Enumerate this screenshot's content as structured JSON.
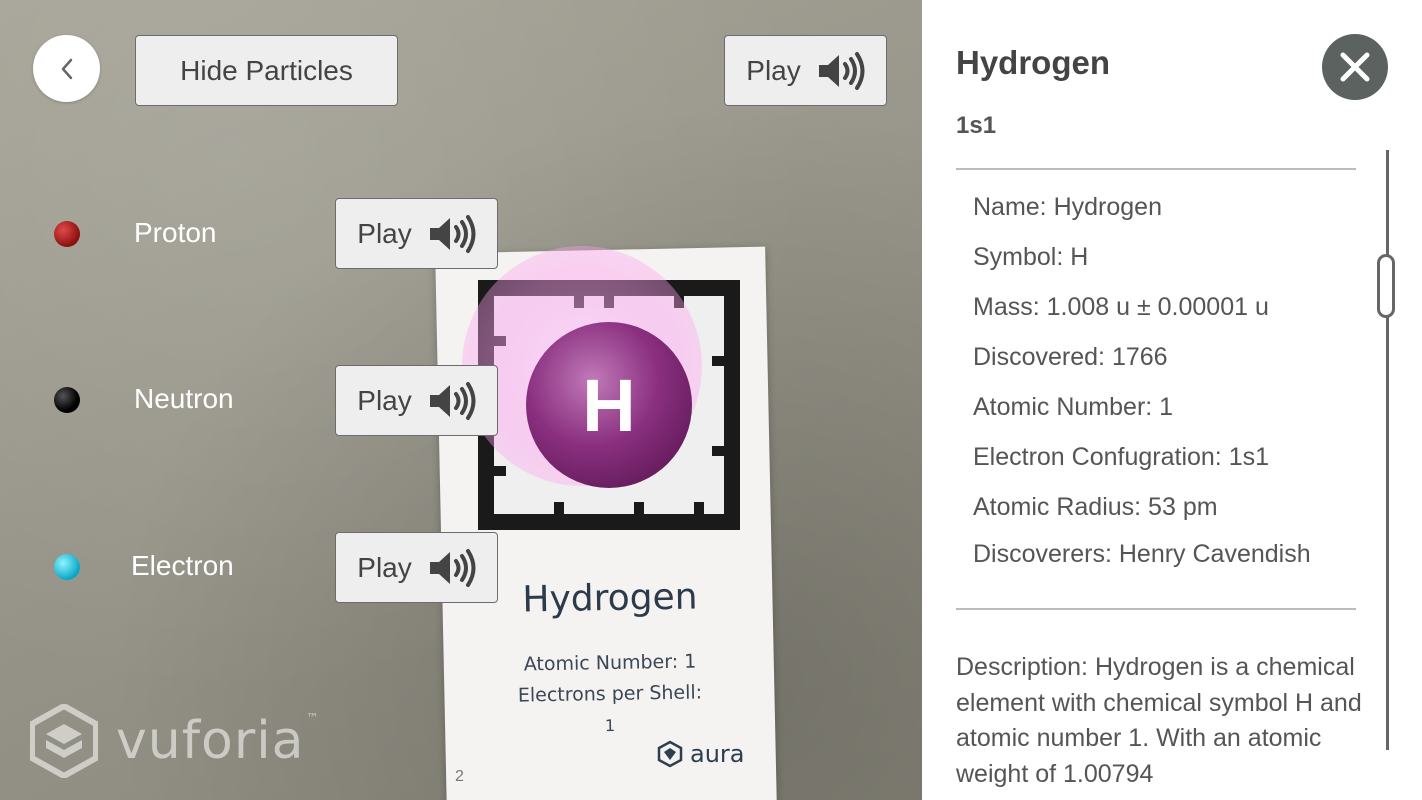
{
  "toolbar": {
    "back_icon": "chevron-left-icon",
    "hide_particles_label": "Hide Particles",
    "play_label": "Play"
  },
  "particles": [
    {
      "label": "Proton",
      "color": "#b81d1d",
      "play_label": "Play"
    },
    {
      "label": "Neutron",
      "color": "#000000",
      "play_label": "Play"
    },
    {
      "label": "Electron",
      "color": "#18c6e6",
      "play_label": "Play"
    }
  ],
  "ar_card": {
    "symbol": "H",
    "title": "Hydrogen",
    "line1": "Atomic Number: 1",
    "line2": "Electrons per Shell:",
    "line3": "1",
    "brand": "aura",
    "page_number": "2"
  },
  "watermark": {
    "text": "vuforia",
    "tm": "™"
  },
  "panel": {
    "title": "Hydrogen",
    "config": "1s1",
    "info": [
      "Name: Hydrogen",
      "Symbol: H",
      "Mass: 1.008 u ± 0.00001 u",
      "Discovered: 1766",
      "Atomic Number: 1",
      "Electron Confugration: 1s1",
      "Atomic Radius: 53 pm",
      "Discoverers: Henry Cavendish"
    ],
    "description": "Description: Hydrogen is a chemical element with chemical symbol H and atomic number 1. With an atomic weight of 1.00794"
  },
  "colors": {
    "panel_bg": "#ffffff",
    "close_bg": "#5b6260",
    "button_bg": "#eeeeee",
    "atom": "#8a2f7f"
  }
}
